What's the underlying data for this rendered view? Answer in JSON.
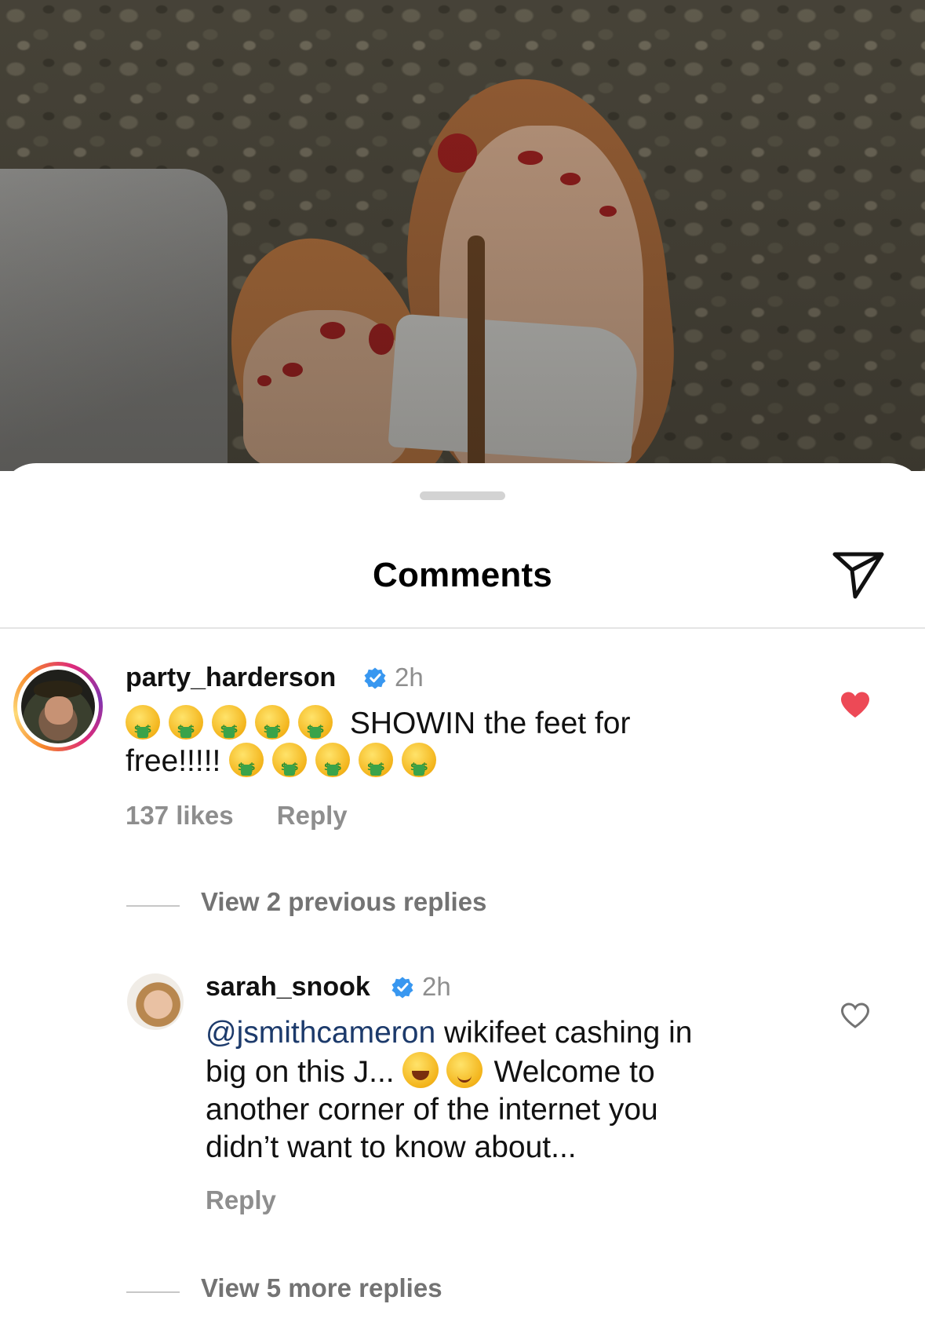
{
  "post_image": {
    "alt": ""
  },
  "sheet": {
    "title": "Comments"
  },
  "comments": [
    {
      "username": "party_harderson",
      "verified": true,
      "time": "2h",
      "text_after_emojis": "SHOWIN the feet for",
      "text_line2": "free!!!!!",
      "emoji_name": "money-mouth-face",
      "likes": "137 likes",
      "reply_label": "Reply",
      "liked": true,
      "heart_color": "#ed4956",
      "view_replies": "View 2 previous replies"
    },
    {
      "username": "sarah_snook",
      "verified": true,
      "time": "2h",
      "mention": "@jsmithcameron",
      "text_line1": " wikifeet cashing in",
      "text_line2": "big on this J... ",
      "text_line2b": "Welcome to",
      "text_line3": "another corner of the internet you",
      "text_line4": "didn’t want to know about...",
      "reply_label": "Reply",
      "liked": false,
      "view_replies": "View 5 more replies"
    }
  ],
  "colors": {
    "verified_blue": "#3897f0",
    "mention": "#1c3a6b",
    "muted": "#8e8e8e"
  }
}
